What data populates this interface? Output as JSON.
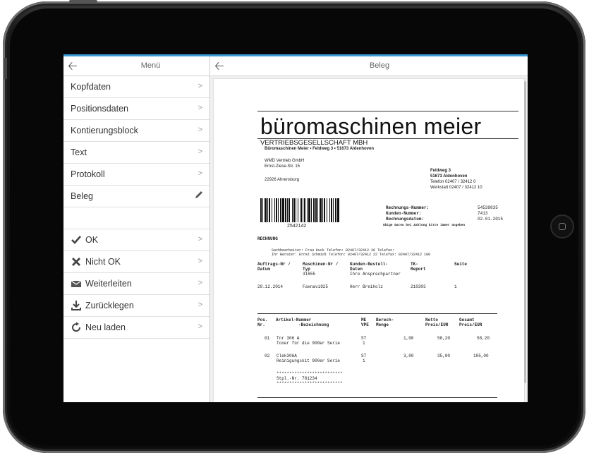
{
  "left_panel": {
    "title": "Menü",
    "items": [
      {
        "label": "Kopfdaten"
      },
      {
        "label": "Positionsdaten"
      },
      {
        "label": "Kontierungsblock"
      },
      {
        "label": "Text"
      },
      {
        "label": "Protokoll"
      },
      {
        "label": "Beleg"
      }
    ],
    "actions": [
      {
        "label": "OK",
        "icon": "check-icon"
      },
      {
        "label": "Nicht OK",
        "icon": "x-icon"
      },
      {
        "label": "Weiterleiten",
        "icon": "mail-icon"
      },
      {
        "label": "Zurücklegen",
        "icon": "download-icon"
      },
      {
        "label": "Neu laden",
        "icon": "reload-icon"
      }
    ]
  },
  "right_panel": {
    "title": "Beleg"
  },
  "document": {
    "company_name": "büromaschinen meier",
    "company_sub": "VERTRIEBSGESELLSCHAFT MBH",
    "sender_line": "Büromaschinen Meier • Feldweg 3 • 51673 Aldenhoven",
    "recipient": [
      "WMD Vertrieb GmbH",
      "Ernst-Ziese-Str. 15",
      "22926 Ahrensburg"
    ],
    "company_address": [
      "Feldweg 3",
      "51673 Aldenhoven",
      "Telefon 02407 / 32412 0",
      "Werkstatt 02407 / 32412 10"
    ],
    "barcode_number": "2542142",
    "meta_labels": [
      "Rechnungs-Nummer:",
      "Kunden-Nummer:",
      "Rechnungsdatum:"
    ],
    "meta_values": [
      "54539835",
      "7413",
      "02.01.2015"
    ],
    "meta_note": "Obige Daten bei Zahlung bitte immer angeben",
    "doc_type": "RECHNUNG",
    "contact_lines": [
      "Sachbearbeiter: Frau Kuck   Telefon: 02407/32412 36     Telefax:",
      "Ihr Berater: Ernst Schmidt  Telefon: 02407/32412 22     Telefax: 02407/32412 100"
    ],
    "order_headers": {
      "auftrag": "Auftrags-Nr /",
      "datum": "Datum",
      "maschine": "Maschinen-Nr /",
      "typ": "Typ",
      "kunden": "Kunden-Bestell-",
      "daten": "Daten",
      "tk": "TK-",
      "report": "Report",
      "seite": "Seite"
    },
    "order_values": {
      "typ_val": "31655",
      "ansprech": "Ihre Ansprechpartner",
      "datum": "29.12.2014",
      "maschine": "Faxnavi925",
      "kunden": "Herr Breiholz",
      "report": "210303",
      "seite": "1"
    },
    "item_headers": {
      "pos": "Pos.",
      "nr": "Nr.",
      "artikel": "Artikel-Nummer",
      "bezeichnung": "-Bezeichnung",
      "me": "ME",
      "vpe": "VPE",
      "berech": "Berech-",
      "menge": "Menge",
      "netto": "Netto",
      "netto2": "Preis/EUR",
      "gesamt": "Gesamt",
      "gesamt2": "Preis/EUR"
    },
    "items": [
      {
        "pos": "01",
        "artikel": "Tnr 306 A",
        "bezeichnung": "Toner für die 900er Serie",
        "me": "ST",
        "vpe": "1",
        "menge": "1,00",
        "netto": "58,20",
        "gesamt": "58,20"
      },
      {
        "pos": "02",
        "artikel": "Clek306A",
        "bezeichnung": "Reinigungskit 900er Serie",
        "me": "ST",
        "vpe": "1",
        "menge": "3,00",
        "netto": "35,00",
        "gesamt": "105,00"
      }
    ],
    "stars": "**************************",
    "stpl": "Stpl.-Nr. 781234"
  },
  "colors": {
    "accent": "#3a9ad9",
    "frame": "#111111"
  }
}
